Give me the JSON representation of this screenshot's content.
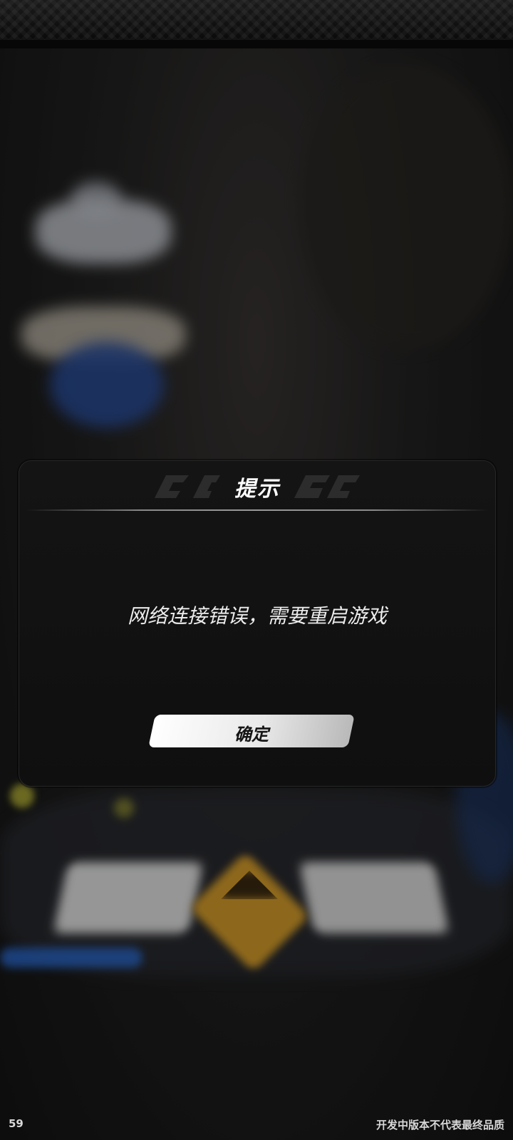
{
  "dialog": {
    "title": "提示",
    "message": "网络连接错误，需要重启游戏",
    "confirm_label": "确定"
  },
  "footer": {
    "fps": "59",
    "build_note": "开发中版本不代表最终品质"
  },
  "colors": {
    "dialog_bg": "#141414",
    "button_bg": "#ffffff",
    "accent_gold": "#d9a02c",
    "accent_blue": "#2d6ed6"
  }
}
